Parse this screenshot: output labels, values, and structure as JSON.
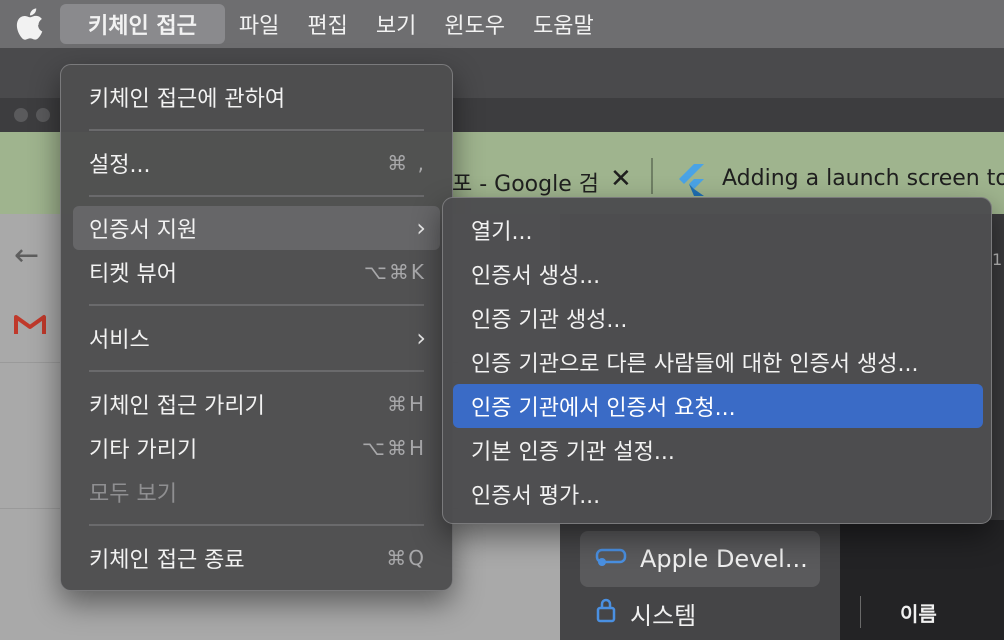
{
  "menubar": {
    "app_name": "키체인 접근",
    "items": [
      "파일",
      "편집",
      "보기",
      "윈도우",
      "도움말"
    ]
  },
  "background": {
    "tab_text_1": "포 - Google 검",
    "tab_text_2": "Adding a launch screen to",
    "sidebar_items": [
      "Apple Devel...",
      "시스템"
    ],
    "column_header": "이름"
  },
  "menu": {
    "about": "키체인 접근에 관하여",
    "settings": "설정...",
    "settings_shortcut": "⌘ ,",
    "cert_assistant": "인증서 지원",
    "ticket_viewer": "티켓 뷰어",
    "ticket_viewer_shortcut": "⌥⌘K",
    "services": "서비스",
    "hide_app": "키체인 접근 가리기",
    "hide_app_shortcut": "⌘H",
    "hide_others": "기타 가리기",
    "hide_others_shortcut": "⌥⌘H",
    "show_all": "모두 보기",
    "quit": "키체인 접근 종료",
    "quit_shortcut": "⌘Q"
  },
  "submenu": {
    "items": [
      "열기...",
      "인증서 생성...",
      "인증 기관 생성...",
      "인증 기관으로 다른 사람들에 대한 인증서 생성...",
      "인증 기관에서 인증서 요청...",
      "기본 인증 기관 설정...",
      "인증서 평가..."
    ],
    "selected_index": 4
  },
  "colors": {
    "selection": "#3a6bc6",
    "menu_bg": "#4e4e50"
  }
}
